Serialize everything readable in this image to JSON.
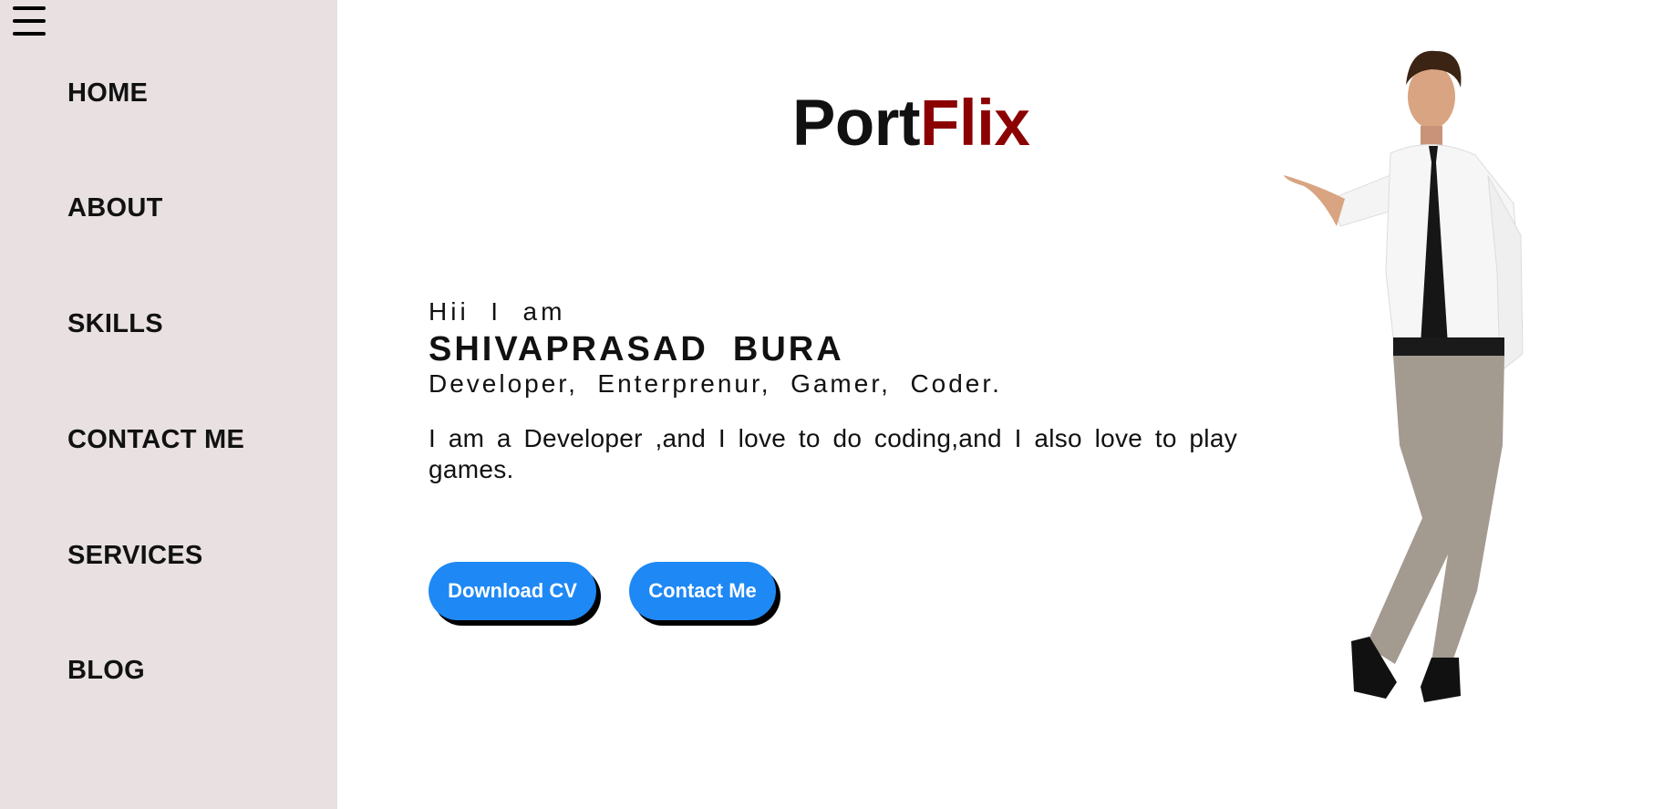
{
  "sidebar": {
    "menu_icon": "hamburger-menu-icon",
    "items": [
      {
        "label": "HOME"
      },
      {
        "label": "ABOUT"
      },
      {
        "label": "SKILLS"
      },
      {
        "label": "CONTACT ME"
      },
      {
        "label": "SERVICES"
      },
      {
        "label": "BLOG"
      }
    ]
  },
  "logo": {
    "part1": "Port",
    "part2": "Flix",
    "accent_color": "#8b0000"
  },
  "hero": {
    "greeting": "Hii  I  am",
    "name": "SHIVAPRASAD  BURA",
    "roles": "Developer,  Enterprenur,  Gamer,  Coder.",
    "about": "I am a Developer ,and I love to do coding,and I also love to play games."
  },
  "buttons": {
    "download_cv": "Download CV",
    "contact_me": "Contact Me",
    "color": "#1e88f5"
  }
}
